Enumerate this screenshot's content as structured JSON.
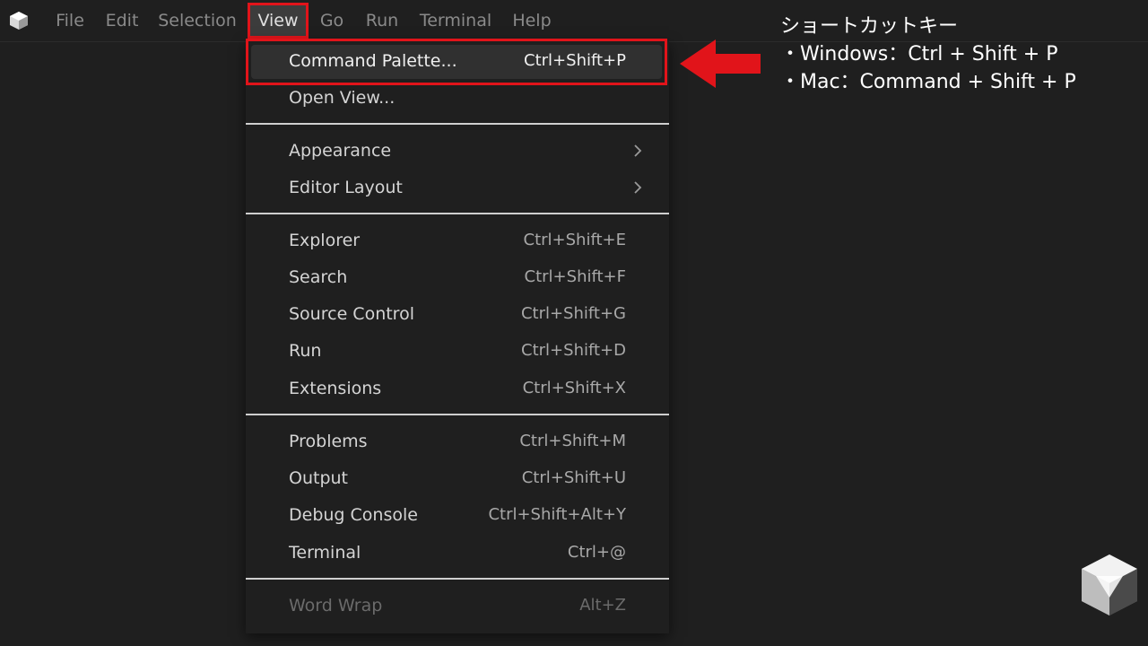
{
  "menubar": {
    "items": [
      {
        "label": "File"
      },
      {
        "label": "Edit"
      },
      {
        "label": "Selection"
      },
      {
        "label": "View"
      },
      {
        "label": "Go"
      },
      {
        "label": "Run"
      },
      {
        "label": "Terminal"
      },
      {
        "label": "Help"
      }
    ]
  },
  "view_menu": {
    "items": [
      {
        "label": "Command Palette...",
        "shortcut": "Ctrl+Shift+P"
      },
      {
        "label": "Open View...",
        "shortcut": ""
      },
      {
        "label": "Appearance",
        "shortcut": ""
      },
      {
        "label": "Editor Layout",
        "shortcut": ""
      },
      {
        "label": "Explorer",
        "shortcut": "Ctrl+Shift+E"
      },
      {
        "label": "Search",
        "shortcut": "Ctrl+Shift+F"
      },
      {
        "label": "Source Control",
        "shortcut": "Ctrl+Shift+G"
      },
      {
        "label": "Run",
        "shortcut": "Ctrl+Shift+D"
      },
      {
        "label": "Extensions",
        "shortcut": "Ctrl+Shift+X"
      },
      {
        "label": "Problems",
        "shortcut": "Ctrl+Shift+M"
      },
      {
        "label": "Output",
        "shortcut": "Ctrl+Shift+U"
      },
      {
        "label": "Debug Console",
        "shortcut": "Ctrl+Shift+Alt+Y"
      },
      {
        "label": "Terminal",
        "shortcut": "Ctrl+@"
      },
      {
        "label": "Word Wrap",
        "shortcut": "Alt+Z"
      }
    ]
  },
  "annotation": {
    "title": "ショートカットキー",
    "windows": "・Windows：Ctrl + Shift + P",
    "mac": "・Mac：Command + Shift + P"
  },
  "colors": {
    "background": "#1f1f1f",
    "highlight_border": "#e1141a",
    "arrow": "#e1141a"
  },
  "icons": {
    "app_logo": "vscode-logo-icon",
    "submenu": "chevron-right-icon",
    "pointer": "arrow-left-icon",
    "watermark": "cube-logo-icon"
  }
}
